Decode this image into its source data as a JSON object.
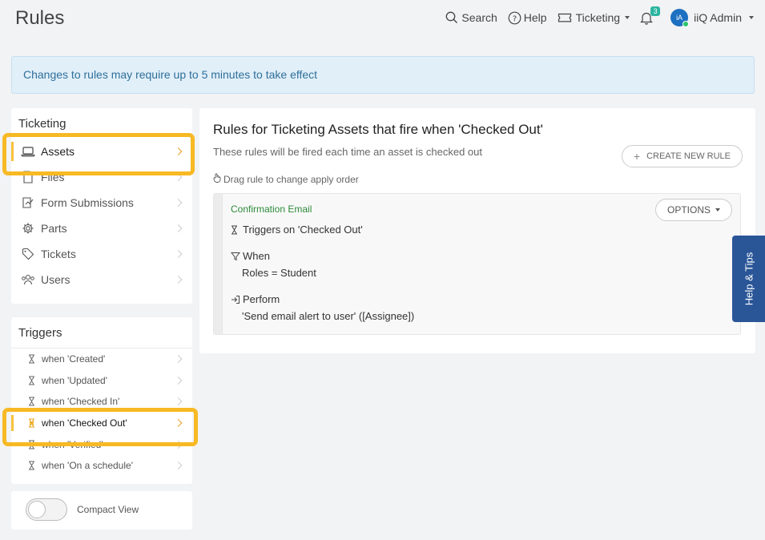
{
  "header": {
    "title": "Rules",
    "search_label": "Search",
    "help_label": "Help",
    "module_label": "Ticketing",
    "notification_count": "3",
    "avatar_initials": "iA",
    "user_name": "iiQ Admin"
  },
  "alert": {
    "text": "Changes to rules may require up to 5 minutes to take effect"
  },
  "sidebar": {
    "section_title": "Ticketing",
    "items": [
      {
        "label": "Assets",
        "icon": "laptop-icon",
        "active": true
      },
      {
        "label": "Files",
        "icon": "file-icon"
      },
      {
        "label": "Form Submissions",
        "icon": "form-icon"
      },
      {
        "label": "Parts",
        "icon": "gear-icon"
      },
      {
        "label": "Tickets",
        "icon": "tag-icon"
      },
      {
        "label": "Users",
        "icon": "users-icon"
      }
    ]
  },
  "triggers": {
    "section_title": "Triggers",
    "items": [
      {
        "prefix": "when '",
        "name": "Created",
        "suffix": "'"
      },
      {
        "prefix": "when '",
        "name": "Updated",
        "suffix": "'"
      },
      {
        "prefix": "when '",
        "name": "Checked In",
        "suffix": "'"
      },
      {
        "prefix": "when '",
        "name": "Checked Out",
        "suffix": "'",
        "active": true
      },
      {
        "prefix": "when '",
        "name": "Verified",
        "suffix": "'"
      },
      {
        "prefix": "when '",
        "name": "On a schedule",
        "suffix": "'"
      }
    ]
  },
  "compact": {
    "label": "Compact View",
    "enabled": false
  },
  "main": {
    "title": "Rules for Ticketing Assets that fire when 'Checked Out'",
    "subtitle": "These rules will be fired each time an asset is checked out",
    "create_button": "CREATE NEW RULE",
    "drag_hint": "Drag rule to change apply order",
    "rule": {
      "name": "Confirmation Email",
      "options_label": "OPTIONS",
      "trigger_text": "Triggers on 'Checked Out'",
      "when_label": "When",
      "when_value": "Roles = Student",
      "perform_label": "Perform",
      "perform_value": "'Send email alert to user' ([Assignee])"
    }
  },
  "help_tab": {
    "label": "Help & Tips"
  },
  "colors": {
    "highlight": "#f7b924",
    "accent": "#2a5698",
    "alert_bg": "#e1eff9",
    "rule_name": "#2e8b3a"
  }
}
